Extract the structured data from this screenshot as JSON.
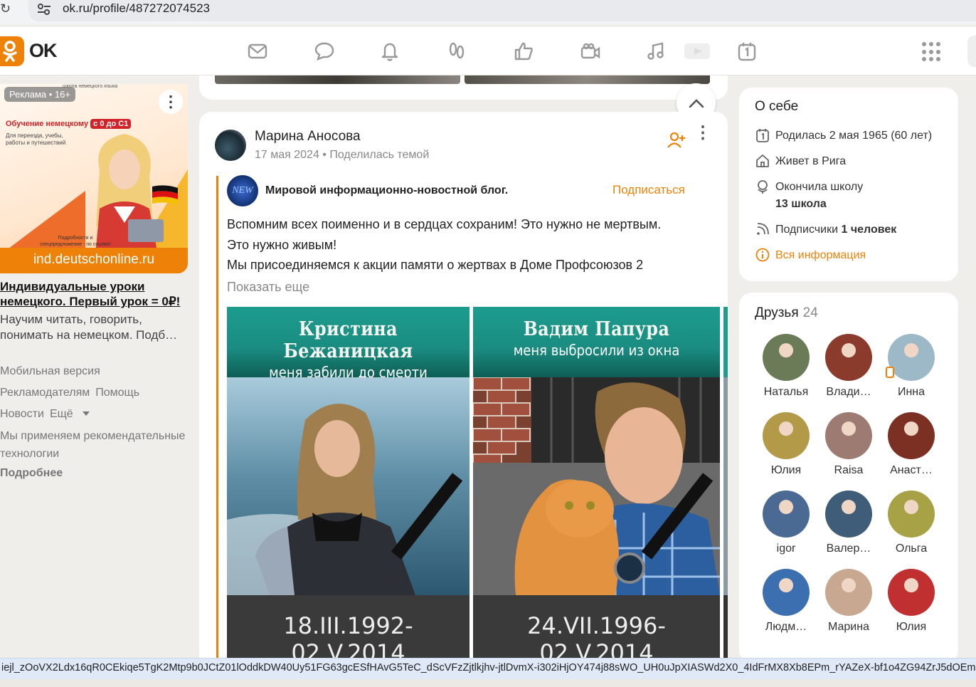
{
  "browser": {
    "url": "ok.ru/profile/487272074523"
  },
  "nav": {
    "logo_text": "OK",
    "icons": [
      "mail-icon",
      "discussions-icon",
      "notifications-icon",
      "guests-icon",
      "marks-icon",
      "video-chat-icon",
      "music-icon",
      "video-icon",
      "calendar-icon"
    ]
  },
  "ad": {
    "label": "Реклама • 16+",
    "school": "школа немецкого языка",
    "headline": "Обучение немецкому",
    "level": "с 0 до С1",
    "subtext": "Для переезда, учебы, работы и путешествий",
    "note": "Подробности и спецпредложение - по ссылке!",
    "domain": "ind.deutschonline.ru",
    "title": "Индивидуальные уроки немецкого. Первый урок = 0₽!",
    "description": "Научим читать, говорить, понимать на немецком. Подб…"
  },
  "footer": {
    "mobile": "Мобильная версия",
    "advertisers": "Рекламодателям",
    "help": "Помощь",
    "news": "Новости",
    "more": "Ещё",
    "tech_text": "Мы применяем рекомендательные технологии",
    "details": "Подробнее"
  },
  "post": {
    "author": "Марина Аносова",
    "date": "17 мая 2024",
    "action": "Поделилась темой",
    "blog_avatar_text": "NEW",
    "blog_name": "Мировой информационно-новостной блог.",
    "subscribe": "Подписаться",
    "text_lines": [
      "Вспомним всех поименно и в сердцах сохраним! Это нужно не мертвым.",
      "Это нужно живым!",
      "Мы присоединяемся к акции памяти о жертвах в Доме Профсоюзов 2"
    ],
    "show_more": "Показать еще",
    "photos": [
      {
        "name": "Кристина Бежаницкая",
        "caption": "меня забили до смерти",
        "dates": "18.III.1992-02.V.2014"
      },
      {
        "name": "Вадим Папура",
        "caption": "меня выбросили из окна",
        "dates": "24.VII.1996-02.V.2014"
      }
    ]
  },
  "about": {
    "title": "О себе",
    "born": "Родилась 2 мая 1965 (60 лет)",
    "lives": "Живет в Рига",
    "school_label": "Окончила школу",
    "school_name": "13 школа",
    "subs_label": "Подписчики",
    "subs_count": "1 человек",
    "all_info": "Вся информация"
  },
  "friends": {
    "title": "Друзья",
    "count": "24",
    "list": [
      {
        "name": "Наталья",
        "color": "#6b7b57"
      },
      {
        "name": "Влади…",
        "color": "#8b3b2b"
      },
      {
        "name": "Инна",
        "color": "#9db9c8"
      },
      {
        "name": "Юлия",
        "color": "#b39a49"
      },
      {
        "name": "Raisa",
        "color": "#9e7b72"
      },
      {
        "name": "Анаст…",
        "color": "#7c2f23"
      },
      {
        "name": "igor",
        "color": "#4a6a94"
      },
      {
        "name": "Валер…",
        "color": "#3f5c78"
      },
      {
        "name": "Ольга",
        "color": "#a7a246"
      },
      {
        "name": "Людм…",
        "color": "#3b6fb0"
      },
      {
        "name": "Марина",
        "color": "#c8a890"
      },
      {
        "name": "Юлия",
        "color": "#c03030"
      }
    ]
  },
  "status_url": "iejl_zOoVX2Ldx16qR0CEkiqe5TgK2Mtp9b0JCtZ01lOddkDW40Uy51FG63gcESfHAvG5TeC_dScVFzZjtlkjhv-jtlDvmX-i302iHjOY474j88sWO_UH0uJpXIASWd2X0_4IdFrMX8Xb8EPm_rYAZeX-bf1o4ZG94ZrJ5dOEmKOC"
}
